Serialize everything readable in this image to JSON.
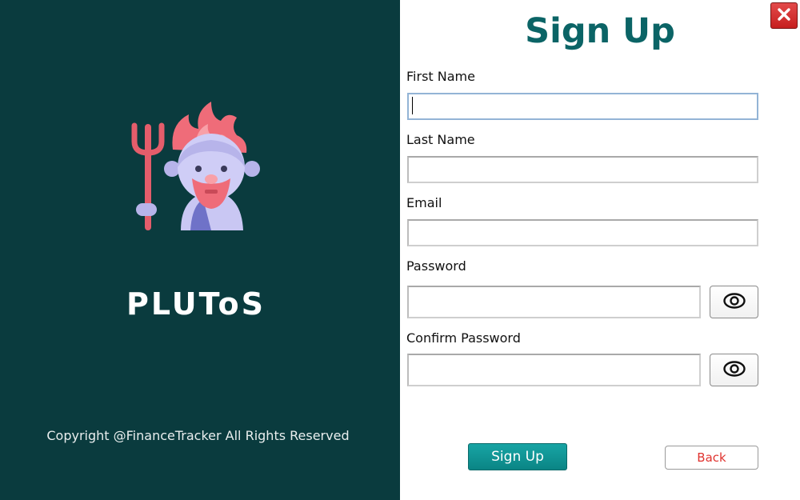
{
  "brand": {
    "name": "PLUToS",
    "copyright": "Copyright @FinanceTracker All Rights Reserved"
  },
  "form": {
    "title": "Sign Up",
    "fields": {
      "first_name": {
        "label": "First Name",
        "value": ""
      },
      "last_name": {
        "label": "Last Name",
        "value": ""
      },
      "email": {
        "label": "Email",
        "value": ""
      },
      "password": {
        "label": "Password",
        "value": ""
      },
      "confirm_password": {
        "label": "Confirm Password",
        "value": ""
      }
    },
    "signup_label": "Sign Up",
    "back_label": "Back"
  },
  "colors": {
    "sidebar_bg": "#0a3b3e",
    "title": "#0b6466",
    "primary_button": "#0f9494",
    "back_text": "#e0332f",
    "close_button": "#d22f2f"
  },
  "icons": {
    "logo": "pluto-mascot-icon",
    "close": "close-icon",
    "password_toggle": "eye-icon"
  }
}
